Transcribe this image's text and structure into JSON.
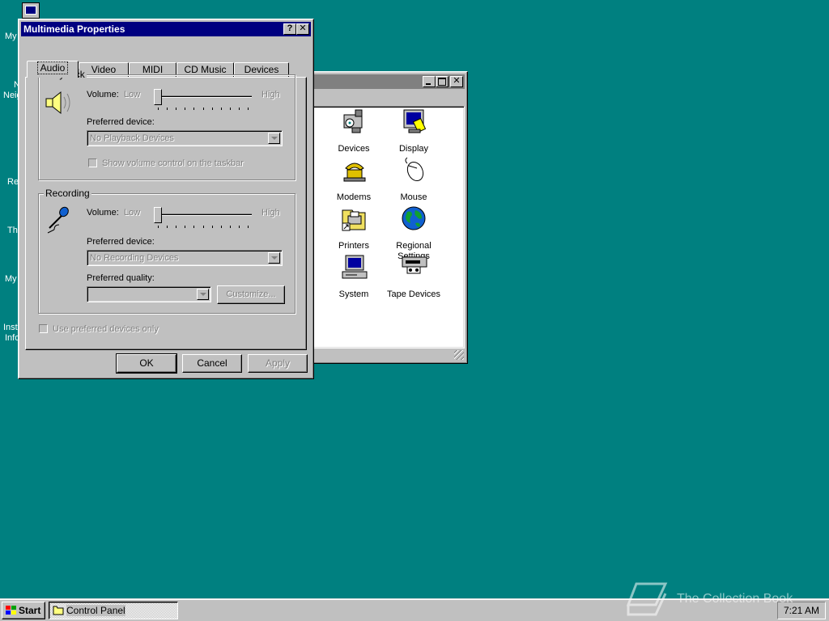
{
  "desktop": {
    "labels": [
      "My",
      "N",
      "Neig",
      "Re",
      "Th",
      "My",
      "Inst",
      "Info"
    ]
  },
  "control_panel": {
    "items": [
      {
        "label": "Devices",
        "icon": "devices-icon"
      },
      {
        "label": "Display",
        "icon": "display-icon"
      },
      {
        "label": "Modems",
        "icon": "modem-icon"
      },
      {
        "label": "Mouse",
        "icon": "mouse-icon"
      },
      {
        "label": "Printers",
        "icon": "printer-icon"
      },
      {
        "label": "Regional Settings",
        "icon": "globe-icon"
      },
      {
        "label": "System",
        "icon": "computer-icon"
      },
      {
        "label": "Tape Devices",
        "icon": "tape-drive-icon"
      }
    ]
  },
  "dialog": {
    "title": "Multimedia Properties",
    "help_button": "?",
    "close_button": "✕",
    "tabs": [
      "Audio",
      "Video",
      "MIDI",
      "CD Music",
      "Devices"
    ],
    "active_tab": "Audio",
    "playback": {
      "group_title": "Playback",
      "volume_label": "Volume:",
      "low": "Low",
      "high": "High",
      "volume_level": 0,
      "device_label": "Preferred device:",
      "device_value": "No Playback Devices",
      "show_volume_label": "Show volume control on the taskbar"
    },
    "recording": {
      "group_title": "Recording",
      "volume_label": "Volume:",
      "low": "Low",
      "high": "High",
      "volume_level": 0,
      "device_label": "Preferred device:",
      "device_value": "No Recording Devices",
      "quality_label": "Preferred quality:",
      "quality_value": "",
      "customize_label": "Customize..."
    },
    "use_preferred_label": "Use preferred devices only",
    "ok": "OK",
    "cancel": "Cancel",
    "apply": "Apply"
  },
  "taskbar": {
    "start": "Start",
    "task": "Control Panel",
    "clock": "7:21 AM"
  },
  "watermark": "The Collection Book"
}
